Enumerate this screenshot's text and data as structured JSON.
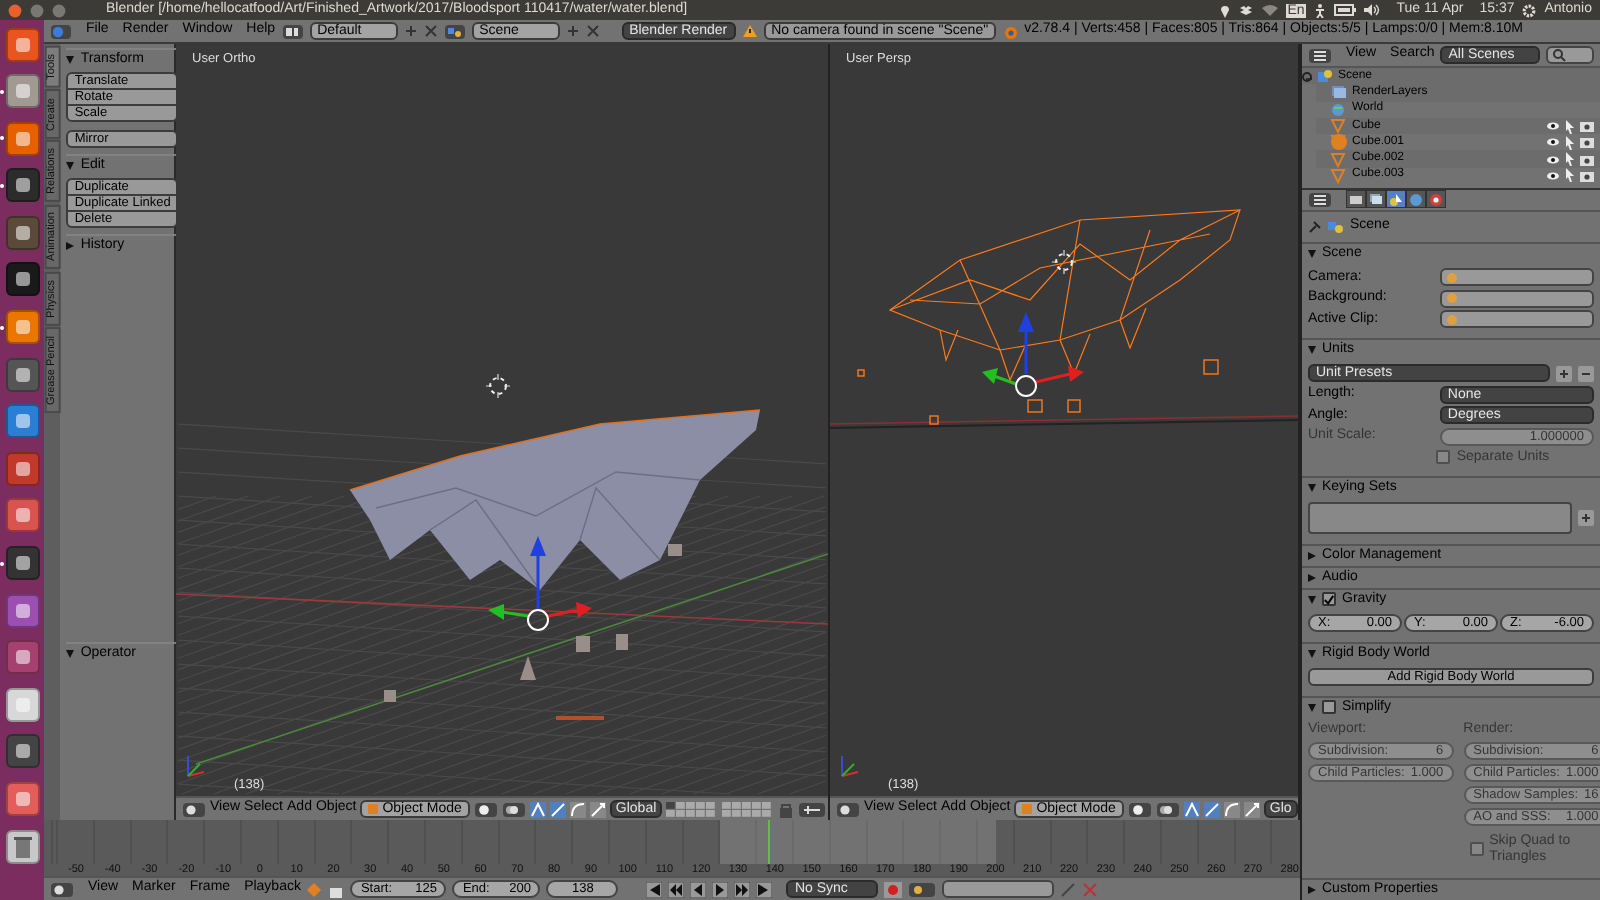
{
  "title_bar": {
    "title": "Blender [/home/hellocatfood/Art/Finished_Artwork/2017/Bloodsport 110417/water/water.blend]",
    "keyboard": "En",
    "date": "Tue 11 Apr",
    "time": "15:37",
    "user": "Antonio"
  },
  "launcher": [
    {
      "kind": "app",
      "color": "#e95420",
      "running": false
    },
    {
      "kind": "app",
      "color": "#a09a92",
      "running": true
    },
    {
      "kind": "app",
      "color": "#e66000",
      "running": true
    },
    {
      "kind": "app",
      "color": "#2c2c2c",
      "running": true
    },
    {
      "kind": "app",
      "color": "#5b4a3a",
      "running": false
    },
    {
      "kind": "app",
      "color": "#1a1a1a",
      "running": false
    },
    {
      "kind": "app",
      "color": "#ea7600",
      "running": true
    },
    {
      "kind": "app",
      "color": "#555555",
      "running": false
    },
    {
      "kind": "app",
      "color": "#2a7fd4",
      "running": false
    },
    {
      "kind": "app",
      "color": "#c0392b",
      "running": false
    },
    {
      "kind": "app",
      "color": "#d9534f",
      "running": false
    },
    {
      "kind": "app",
      "color": "#333333",
      "running": true
    },
    {
      "kind": "app",
      "color": "#9b4fb0",
      "running": false
    },
    {
      "kind": "app",
      "color": "#a4416f",
      "running": false
    },
    {
      "kind": "app",
      "color": "#d8d8d8",
      "running": false
    },
    {
      "kind": "app",
      "color": "#444444",
      "running": false
    },
    {
      "kind": "app",
      "color": "#e35d5b",
      "running": false
    },
    {
      "kind": "trash",
      "color": "#c8c8c8",
      "running": false
    }
  ],
  "info_header": {
    "menus": [
      "File",
      "Render",
      "Window",
      "Help"
    ],
    "layout": "Default",
    "scene": "Scene",
    "engine": "Blender Render",
    "warning": "No camera found in scene \"Scene\"",
    "stats": "v2.78.4 | Verts:458 | Faces:805 | Tris:864 | Objects:5/5 | Lamps:0/0 | Mem:8.10M"
  },
  "tool_shelf": {
    "tabs": [
      {
        "label": "Tools",
        "selected": true
      },
      {
        "label": "Create",
        "selected": false
      },
      {
        "label": "Relations",
        "selected": false
      },
      {
        "label": "Animation",
        "selected": false
      },
      {
        "label": "Physics",
        "selected": false
      },
      {
        "label": "Grease Pencil",
        "selected": false
      }
    ],
    "panels": [
      {
        "title": "Transform",
        "expanded": true,
        "groups": [
          [
            "Translate",
            "Rotate",
            "Scale"
          ],
          [
            "Mirror"
          ]
        ]
      },
      {
        "title": "Edit",
        "expanded": true,
        "groups": [
          [
            "Duplicate",
            "Duplicate Linked",
            "Delete"
          ]
        ]
      },
      {
        "title": "History",
        "expanded": false
      }
    ],
    "operator": {
      "title": "Operator",
      "expanded": true
    }
  },
  "viewports": [
    {
      "kind": "solid",
      "view": "User Ortho",
      "frame": "(138)",
      "header": {
        "menus": [
          "View",
          "Select",
          "Add",
          "Object"
        ],
        "mode": "Object Mode",
        "orientation": "Global"
      }
    },
    {
      "kind": "wireframe",
      "view": "User Persp",
      "frame": "(138)",
      "header": {
        "menus": [
          "View",
          "Select",
          "Add",
          "Object"
        ],
        "mode": "Object Mode",
        "orientation": "Glo"
      }
    }
  ],
  "timeline": {
    "ruler": [
      "-50",
      "-40",
      "-30",
      "-20",
      "-10",
      "0",
      "10",
      "20",
      "30",
      "40",
      "50",
      "60",
      "70",
      "80",
      "90",
      "100",
      "110",
      "120",
      "130",
      "140",
      "150",
      "160",
      "170",
      "180",
      "190",
      "200",
      "210",
      "220",
      "230",
      "240",
      "250",
      "260",
      "270",
      "280"
    ],
    "playhead": {
      "level": 0.576
    },
    "header": {
      "menus": [
        "View",
        "Marker",
        "Frame",
        "Playback"
      ],
      "start_label": "Start:",
      "start": "125",
      "end_label": "End:",
      "end": "200",
      "current": "138",
      "sync": "No Sync"
    }
  },
  "outliner": {
    "menus": [
      "View",
      "Search"
    ],
    "filter": "All Scenes",
    "tree": [
      {
        "label": "Scene",
        "kind": "scene",
        "expanded": true,
        "selected": false,
        "children": [
          {
            "label": "RenderLayers",
            "kind": "renderlayers",
            "selected": false
          },
          {
            "label": "World",
            "kind": "world",
            "selected": false
          },
          {
            "label": "Cube",
            "kind": "object",
            "selected": false
          },
          {
            "label": "Cube.001",
            "kind": "object",
            "selected": true
          },
          {
            "label": "Cube.002",
            "kind": "object",
            "selected": false
          },
          {
            "label": "Cube.003",
            "kind": "object",
            "selected": false
          }
        ]
      }
    ]
  },
  "properties": {
    "tabs": [
      {
        "kind": "render",
        "selected": false
      },
      {
        "kind": "render_layers",
        "selected": false
      },
      {
        "kind": "scene",
        "selected": true
      },
      {
        "kind": "world",
        "selected": false
      },
      {
        "kind": "object",
        "selected": false
      }
    ],
    "breadcrumb": "Scene",
    "panels": [
      {
        "title": "Scene",
        "expanded": true,
        "rows": [
          {
            "kind": "field",
            "label": "Camera:"
          },
          {
            "kind": "field",
            "label": "Background:"
          },
          {
            "kind": "field",
            "label": "Active Clip:"
          }
        ]
      },
      {
        "title": "Units",
        "expanded": true,
        "rows": [
          {
            "kind": "presets",
            "value": "Unit Presets",
            "disabled": false
          },
          {
            "kind": "dropdown",
            "label": "Length:",
            "value": "None",
            "disabled": false
          },
          {
            "kind": "dropdown",
            "label": "Angle:",
            "value": "Degrees",
            "disabled": false
          },
          {
            "kind": "number",
            "label": "Unit Scale:",
            "value": "1.000000",
            "disabled": true
          },
          {
            "kind": "checkbox",
            "label": "Separate Units",
            "checked": false,
            "disabled": true
          }
        ]
      },
      {
        "title": "Keying Sets",
        "expanded": true,
        "rows": [
          {
            "kind": "listbox"
          }
        ]
      },
      {
        "title": "Color Management",
        "expanded": false
      },
      {
        "title": "Audio",
        "expanded": false
      },
      {
        "title": "Gravity",
        "expanded": true,
        "checked": true,
        "rows": [
          {
            "kind": "vector",
            "items": [
              {
                "label": "X:",
                "value": "0.00"
              },
              {
                "label": "Y:",
                "value": "0.00"
              },
              {
                "label": "Z:",
                "value": "-6.00"
              }
            ]
          }
        ]
      },
      {
        "title": "Rigid Body World",
        "expanded": true,
        "rows": [
          {
            "kind": "button",
            "label": "Add Rigid Body World"
          }
        ]
      },
      {
        "title": "Simplify",
        "expanded": true,
        "checked": false,
        "rows": [
          {
            "kind": "columns",
            "disabled": true,
            "columns": [
              {
                "heading": "Viewport:",
                "items": [
                  {
                    "kind": "number",
                    "label": "Subdivision:",
                    "value": "6"
                  },
                  {
                    "kind": "number",
                    "label": "Child Particles:",
                    "value": "1.000"
                  }
                ]
              },
              {
                "heading": "Render:",
                "items": [
                  {
                    "kind": "number",
                    "label": "Subdivision:",
                    "value": "6"
                  },
                  {
                    "kind": "number",
                    "label": "Child Particles:",
                    "value": "1.000"
                  },
                  {
                    "kind": "number",
                    "label": "Shadow Samples:",
                    "value": "16"
                  },
                  {
                    "kind": "number",
                    "label": "AO and SSS:",
                    "value": "1.000"
                  },
                  {
                    "kind": "checkbox",
                    "label": "Skip Quad to Triangles",
                    "checked": false
                  }
                ]
              }
            ]
          }
        ]
      },
      {
        "title": "Custom Properties",
        "expanded": false
      }
    ]
  }
}
